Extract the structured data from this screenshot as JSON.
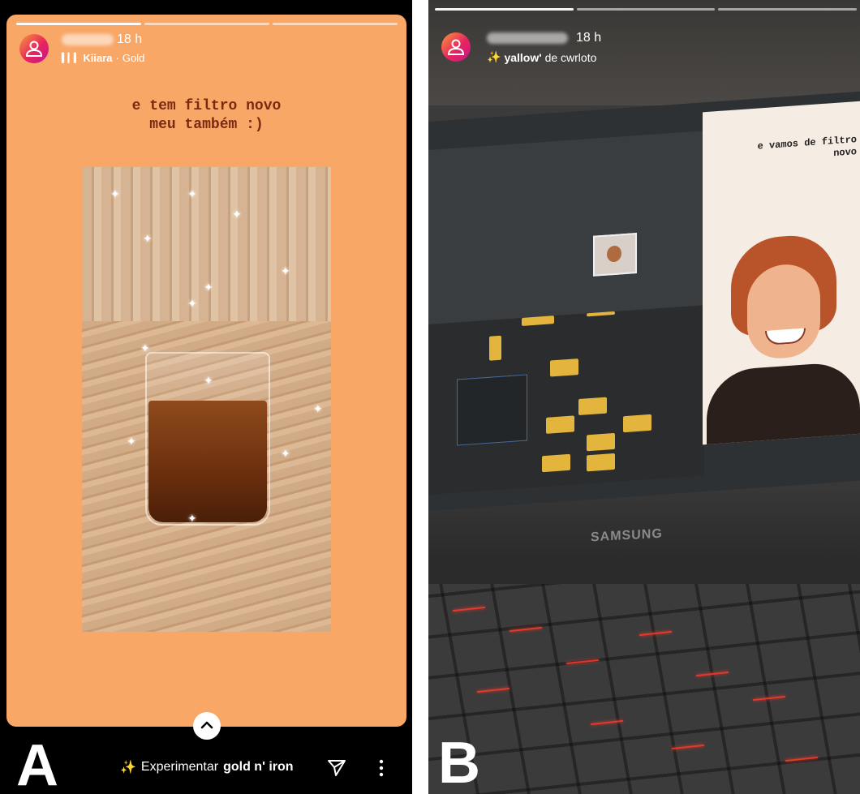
{
  "panel_a": {
    "letter": "A",
    "time": "18 h",
    "music_icon": "music-bars-icon",
    "subtitle_song": "Kiiara",
    "subtitle_sep": "·",
    "subtitle_artist": "Gold",
    "caption_line1": "e tem filtro novo",
    "caption_line2": "meu também :)",
    "try_label": "Experimentar",
    "try_effect": "gold n' iron",
    "colors": {
      "background": "#f8a767",
      "caption": "#7a2a10"
    }
  },
  "panel_b": {
    "letter": "B",
    "time": "18 h",
    "effect_name": "yallow'",
    "effect_author": "de cwrloto",
    "screen_caption_line1": "e vamos de filtro",
    "screen_caption_line2": "novo",
    "brand": "SAMSUNG"
  },
  "progress": {
    "a_total": 3,
    "a_done": 1,
    "b_total": 3,
    "b_done": 1
  }
}
